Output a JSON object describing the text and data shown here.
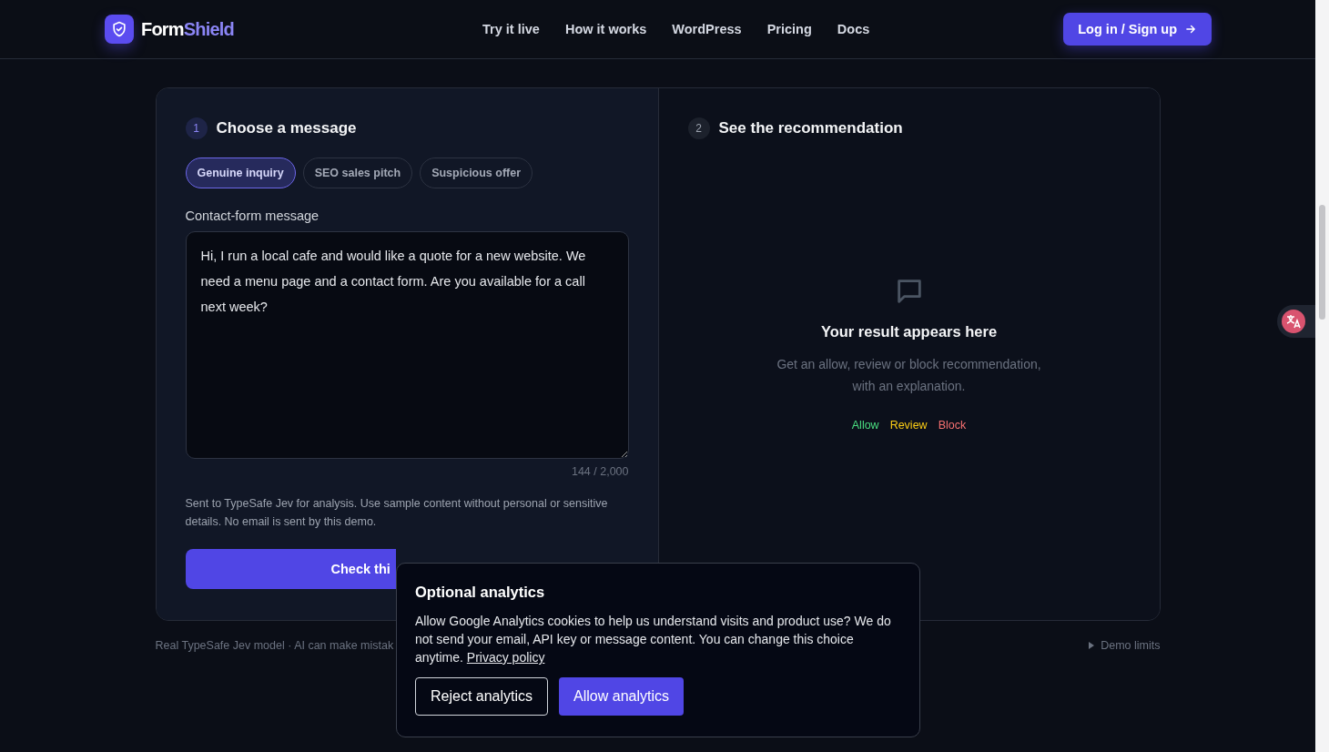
{
  "header": {
    "logo": {
      "first": "Form",
      "second": "Shield"
    },
    "nav": [
      "Try it live",
      "How it works",
      "WordPress",
      "Pricing",
      "Docs"
    ],
    "login": "Log in / Sign up"
  },
  "step1": {
    "number": "1",
    "title": "Choose a message",
    "samples": [
      {
        "label": "Genuine inquiry",
        "selected": true
      },
      {
        "label": "SEO sales pitch",
        "selected": false
      },
      {
        "label": "Suspicious offer",
        "selected": false
      }
    ],
    "field_label": "Contact-form message",
    "message": "Hi, I run a local cafe and would like a quote for a new website. We need a menu page and a contact form. Are you available for a call next week?",
    "counter": "144 / 2,000",
    "note": "Sent to TypeSafe Jev for analysis. Use sample content without personal or sensitive details. No email is sent by this demo.",
    "submit": "Check thi"
  },
  "step2": {
    "number": "2",
    "title": "See the recommendation",
    "empty_title": "Your result appears here",
    "empty_text": "Get an allow, review or block recommendation, with an explanation.",
    "legend": [
      {
        "label": "Allow",
        "color": "#4ade80"
      },
      {
        "label": "Review",
        "color": "#facc15"
      },
      {
        "label": "Block",
        "color": "#f87171"
      }
    ]
  },
  "footer": {
    "left": "Real TypeSafe Jev model · AI can make mistak",
    "right": "Demo limits"
  },
  "cookie_banner": {
    "title": "Optional analytics",
    "text": "Allow Google Analytics cookies to help us understand visits and product use? We do not send your email, API key or message content. You can change this choice anytime.",
    "link": "Privacy policy",
    "reject": "Reject analytics",
    "accept": "Allow analytics"
  }
}
